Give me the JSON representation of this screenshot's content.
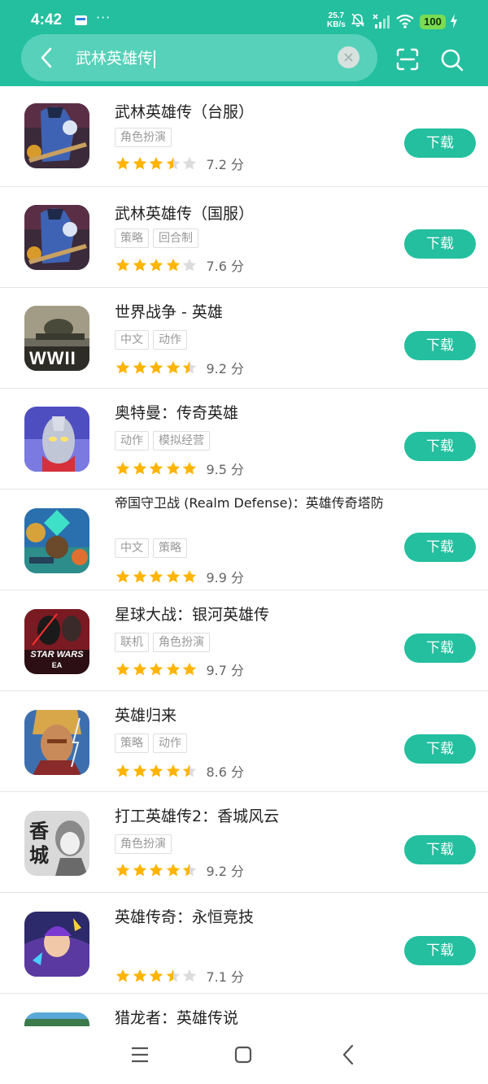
{
  "status_bar": {
    "time": "4:42",
    "net_speed_value": "25.7",
    "net_speed_unit": "KB/s",
    "battery": "100",
    "icons": [
      "sim-card-icon",
      "more-dots-icon",
      "bell-muted-icon",
      "signal-icon",
      "wifi-icon",
      "battery-icon",
      "charging-icon"
    ]
  },
  "search": {
    "query": "武林英雄传",
    "more_dots": "···"
  },
  "colors": {
    "accent": "#23bf9f",
    "search_field": "#57d1b9",
    "star": "#ffb400",
    "star_empty": "#dcdcdc",
    "tag_text": "#999999"
  },
  "results": [
    {
      "title": "武林英雄传（台服）",
      "tags": [
        "角色扮演"
      ],
      "rating": 3.5,
      "score": "7.2 分",
      "button": "下载",
      "icon": "wulin-game-icon"
    },
    {
      "title": "武林英雄传（国服）",
      "tags": [
        "策略",
        "回合制"
      ],
      "rating": 4,
      "score": "7.6 分",
      "button": "下载",
      "icon": "wulin-game-icon"
    },
    {
      "title": "世界战争 - 英雄",
      "tags": [
        "中文",
        "动作"
      ],
      "rating": 4.5,
      "score": "9.2 分",
      "button": "下载",
      "icon": "wwii-game-icon",
      "icon_text": "WWII"
    },
    {
      "title": "奥特曼：传奇英雄",
      "tags": [
        "动作",
        "模拟经营"
      ],
      "rating": 5,
      "score": "9.5 分",
      "button": "下载",
      "icon": "ultraman-game-icon"
    },
    {
      "title": "帝国守卫战 (Realm Defense)：英雄传奇塔防",
      "tags": [
        "中文",
        "策略"
      ],
      "rating": 5,
      "score": "9.9 分",
      "button": "下载",
      "icon": "realm-defense-game-icon"
    },
    {
      "title": "星球大战：银河英雄传",
      "tags": [
        "联机",
        "角色扮演"
      ],
      "rating": 5,
      "score": "9.7 分",
      "button": "下载",
      "icon": "star-wars-game-icon",
      "icon_text": "STAR WARS",
      "icon_subtext": "EA"
    },
    {
      "title": "英雄归来",
      "tags": [
        "策略",
        "动作"
      ],
      "rating": 4.5,
      "score": "8.6 分",
      "button": "下载",
      "icon": "hero-return-game-icon"
    },
    {
      "title": "打工英雄传2：香城风云",
      "tags": [
        "角色扮演"
      ],
      "rating": 4.5,
      "score": "9.2 分",
      "button": "下载",
      "icon": "hong-kong-game-icon",
      "icon_text": "香城"
    },
    {
      "title": "英雄传奇：永恒竞技",
      "tags": [],
      "rating": 3.5,
      "score": "7.1 分",
      "button": "下载",
      "icon": "hero-legend-game-icon"
    },
    {
      "title": "猎龙者：英雄传说",
      "tags": [],
      "rating": 0,
      "score": "",
      "button": "",
      "icon": "dragon-hunter-game-icon"
    }
  ],
  "nav_bar": {
    "icons": [
      "menu-icon",
      "home-icon",
      "back-icon"
    ]
  }
}
